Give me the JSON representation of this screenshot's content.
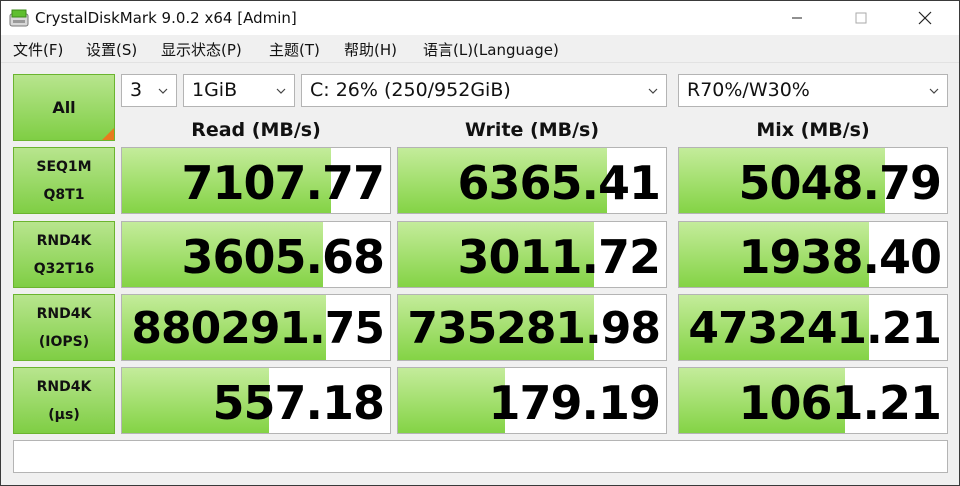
{
  "window": {
    "title": "CrystalDiskMark 9.0.2 x64 [Admin]"
  },
  "menu": [
    "文件(F)",
    "设置(S)",
    "显示状态(P)",
    "主题(T)",
    "帮助(H)",
    "语言(L)(Language)"
  ],
  "controls": {
    "all_label": "All",
    "count": "3",
    "size": "1GiB",
    "drive": "C: 26% (250/952GiB)",
    "mix": "R70%/W30%"
  },
  "columns": {
    "read": "Read (MB/s)",
    "write": "Write (MB/s)",
    "mix": "Mix (MB/s)"
  },
  "rows": [
    {
      "line1": "SEQ1M",
      "line2": "Q8T1",
      "read": "7107.77",
      "write": "6365.41",
      "mix": "5048.79",
      "read_fill": 0.78,
      "write_fill": 0.78,
      "mix_fill": 0.77
    },
    {
      "line1": "RND4K",
      "line2": "Q32T16",
      "read": "3605.68",
      "write": "3011.72",
      "mix": "1938.40",
      "read_fill": 0.75,
      "write_fill": 0.73,
      "mix_fill": 0.71
    },
    {
      "line1": "RND4K",
      "line2": "(IOPS)",
      "read": "880291.75",
      "write": "735281.98",
      "mix": "473241.21",
      "read_fill": 0.76,
      "write_fill": 0.73,
      "mix_fill": 0.71
    },
    {
      "line1": "RND4K",
      "line2": "(μs)",
      "read": "557.18",
      "write": "179.19",
      "mix": "1061.21",
      "read_fill": 0.55,
      "write_fill": 0.4,
      "mix_fill": 0.62
    }
  ],
  "status_text": "",
  "colors": {
    "bar_green": "#84d345",
    "label_green": "#7fce44",
    "corner_orange": "#e87b1e"
  }
}
